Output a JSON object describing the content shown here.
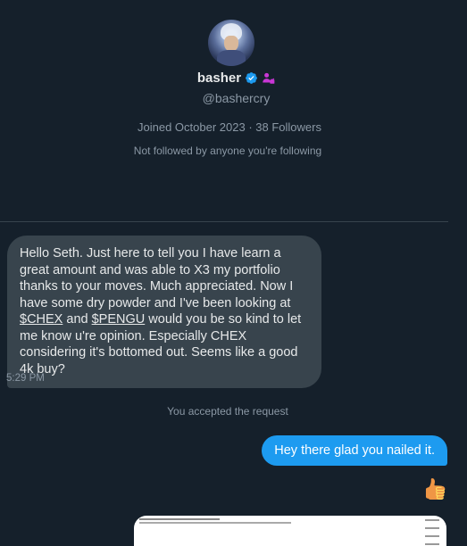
{
  "profile": {
    "display_name": "basher",
    "handle": "@bashercry",
    "joined_text": "Joined October 2023 · 38 Followers",
    "followed_by_text": "Not followed by anyone you're following"
  },
  "conversation": {
    "incoming_message": {
      "text_before_chex": "Hello Seth. Just here to tell you I have learn a great amount and was able to X3 my portfolio thanks to your moves. Much appreciated. Now I have some dry powder and I've been looking at ",
      "chex_link": "$CHEX",
      "text_between": " and ",
      "pengu_link": "$PENGU",
      "text_after": " would you be so kind to let me know u're opinion. Especially CHEX considering it's bottomed out. Seems like a good 4k buy?",
      "time": "5:29 PM"
    },
    "system_note": "You accepted the request",
    "outgoing_message": {
      "text": "Hey there glad you nailed it."
    },
    "reaction_emoji": "thumbs-up-icon"
  },
  "colors": {
    "background": "#15202b",
    "incoming_bubble": "#38444d",
    "outgoing_bubble": "#1d9bf0",
    "muted_text": "#8b98a5",
    "verified_badge": "#1d9bf0",
    "affiliate_badge": "#c936d6"
  }
}
